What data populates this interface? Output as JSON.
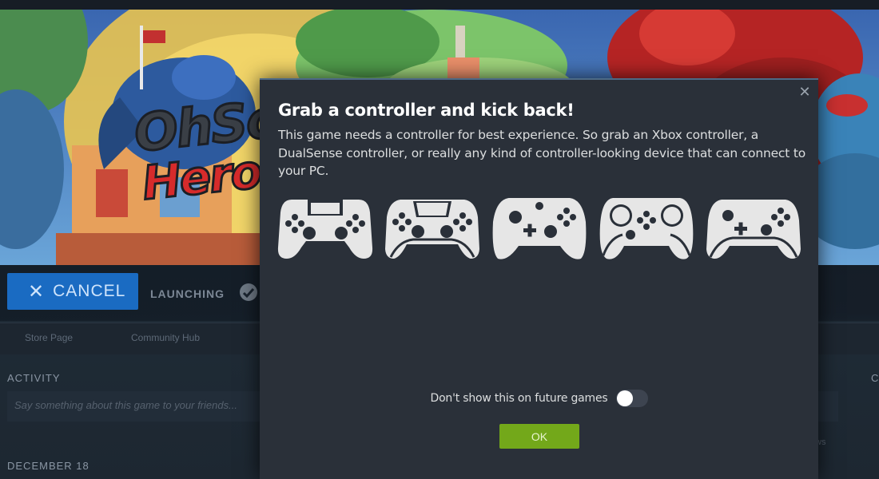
{
  "game": {
    "logo_line1": "OhSo",
    "logo_line2": "Hero",
    "cancel_label": "CANCEL",
    "status_label": "LAUNCHING",
    "subnav": [
      "Store Page",
      "Community Hub"
    ],
    "activity_heading": "ACTIVITY",
    "activity_placeholder": "Say something about this game to your friends...",
    "date_heading": "DECEMBER 18",
    "right_heading_fragment": "C",
    "right_text_fragment": "ws"
  },
  "modal": {
    "title": "Grab a controller and kick back!",
    "body": "This game needs a controller for best experience. So grab an Xbox controller, a DualSense controller, or really any kind of controller-looking device that can connect to your PC.",
    "close_icon": "close-icon",
    "controller_icons": [
      "dualshock-controller-icon",
      "dualsense-controller-icon",
      "xbox-controller-icon",
      "steam-controller-icon",
      "switch-pro-controller-icon"
    ],
    "toggle_label": "Don't show this on future games",
    "toggle_on": false,
    "ok_label": "OK"
  },
  "colors": {
    "modal_bg": "#2a3039",
    "ok_green": "#73a81a",
    "cancel_blue": "#1a6bc2",
    "controller_fill": "#e6e6e6"
  }
}
